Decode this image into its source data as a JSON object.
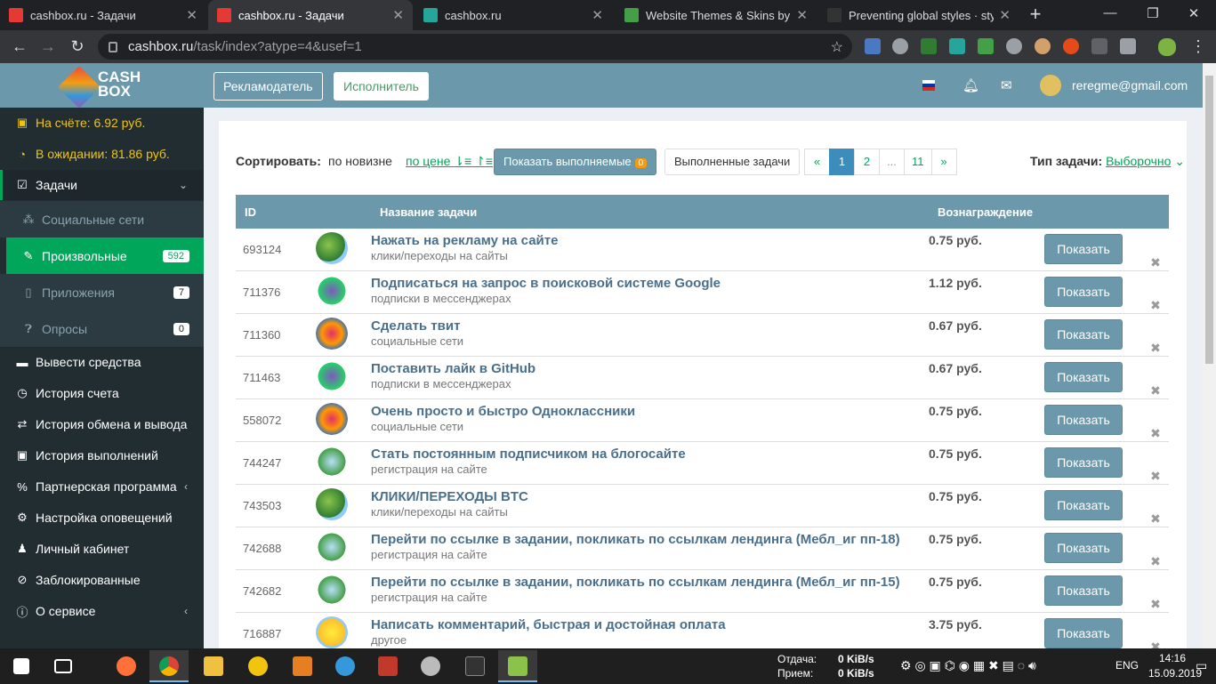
{
  "browser": {
    "tabs": [
      {
        "title": "cashbox.ru - Задачи",
        "fav": "#e53935"
      },
      {
        "title": "cashbox.ru - Задачи",
        "fav": "#e53935",
        "active": true
      },
      {
        "title": "cashbox.ru",
        "fav": "#26a69a"
      },
      {
        "title": "Website Themes & Skins by Sty",
        "fav": "#43a047"
      },
      {
        "title": "Preventing global styles · stylis",
        "fav": "#333333"
      }
    ],
    "url_host": "cashbox.ru",
    "url_path": "/task/index?atype=4&usef=1"
  },
  "header": {
    "advertiser_label": "Рекламодатель",
    "performer_label": "Исполнитель",
    "user_email": "reregme@gmail.com"
  },
  "sidebar": {
    "balance": "На счёте: 6.92 руб.",
    "pending": "В ожидании: 81.86 руб.",
    "tasks_label": "Задачи",
    "sub": [
      {
        "label": "Социальные сети",
        "badge": ""
      },
      {
        "label": "Произвольные",
        "badge": "592"
      },
      {
        "label": "Приложения",
        "badge": "7"
      },
      {
        "label": "Опросы",
        "badge": "0"
      }
    ],
    "items": [
      "Вывести средства",
      "История счета",
      "История обмена и вывода",
      "История выполнений",
      "Партнерская программа",
      "Настройка оповещений",
      "Личный кабинет",
      "Заблокированные",
      "О сервисе"
    ]
  },
  "toolbar": {
    "sort_label": "Сортировать:",
    "sort_new": "по новизне",
    "sort_price": "по цене",
    "show_active": "Показать выполняемые",
    "show_active_count": "0",
    "done_tasks": "Выполненные задачи",
    "pages": [
      "«",
      "1",
      "2",
      "...",
      "11",
      "»"
    ],
    "type_label": "Тип задачи:",
    "type_value": "Выборочно"
  },
  "table": {
    "headers": [
      "ID",
      "Название задачи",
      "Вознаграждение"
    ],
    "show_label": "Показать",
    "rows": [
      {
        "id": "693124",
        "name": "Нажать на рекламу на сайте",
        "cat": "клики/переходы на сайты",
        "reward": "0.75 руб.",
        "icon": "globe-click-icon"
      },
      {
        "id": "711376",
        "name": "Подписаться на запрос в поисковой системе Google",
        "cat": "подписки в мессенджерах",
        "reward": "1.12 руб.",
        "icon": "messenger-icon"
      },
      {
        "id": "711360",
        "name": "Сделать твит",
        "cat": "социальные сети",
        "reward": "0.67 руб.",
        "icon": "social-icon"
      },
      {
        "id": "711463",
        "name": "Поставить лайк в GitHub",
        "cat": "подписки в мессенджерах",
        "reward": "0.67 руб.",
        "icon": "messenger-icon"
      },
      {
        "id": "558072",
        "name": "Очень просто и быстро Одноклассники",
        "cat": "социальные сети",
        "reward": "0.75 руб.",
        "icon": "social-icon"
      },
      {
        "id": "744247",
        "name": "Стать постоянным подписчиком на блогосайте",
        "cat": "регистрация на сайте",
        "reward": "0.75 руб.",
        "icon": "registration-icon"
      },
      {
        "id": "743503",
        "name": "КЛИКИ/ПЕРЕХОДЫ BTC",
        "cat": "клики/переходы на сайты",
        "reward": "0.75 руб.",
        "icon": "globe-click-icon"
      },
      {
        "id": "742688",
        "name": "Перейти по ссылке в задании, покликать по ссылкам лендинга (Мебл_иг пп-18)",
        "cat": "регистрация на сайте",
        "reward": "0.75 руб.",
        "icon": "registration-icon"
      },
      {
        "id": "742682",
        "name": "Перейти по ссылке в задании, покликать по ссылкам лендинга (Мебл_иг пп-15)",
        "cat": "регистрация на сайте",
        "reward": "0.75 руб.",
        "icon": "registration-icon"
      },
      {
        "id": "716887",
        "name": "Написать комментарий, быстрая и достойная оплата",
        "cat": "другое",
        "reward": "3.75 руб.",
        "icon": "lightbulb-icon"
      }
    ]
  },
  "taskbar": {
    "upload_label": "Отдача:",
    "upload_value": "0 KiB/s",
    "download_label": "Прием:",
    "download_value": "0 KiB/s",
    "lang": "ENG",
    "time": "14:16",
    "date": "15.09.2019"
  }
}
